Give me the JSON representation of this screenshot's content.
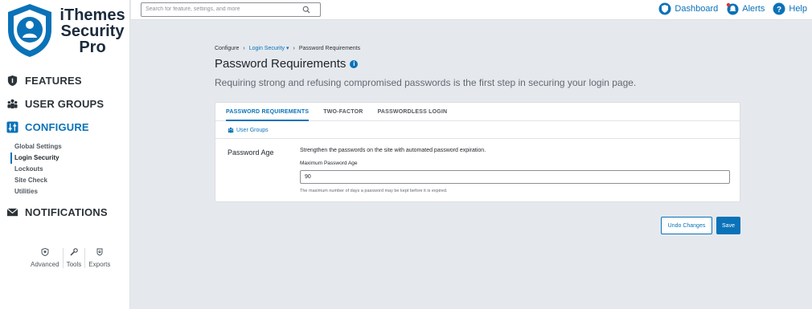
{
  "brand": {
    "line1": "iThemes",
    "line2": "Security",
    "line3": "Pro",
    "accent": "#0a72b8",
    "logo_icon": "shield-user-icon"
  },
  "sidebar": {
    "sections": [
      {
        "label": "FEATURES",
        "icon": "shield-icon"
      },
      {
        "label": "USER GROUPS",
        "icon": "users-icon"
      },
      {
        "label": "CONFIGURE",
        "icon": "sliders-icon"
      },
      {
        "label": "NOTIFICATIONS",
        "icon": "envelope-icon"
      }
    ],
    "configure_items": [
      {
        "label": "Global Settings"
      },
      {
        "label": "Login Security",
        "current": true
      },
      {
        "label": "Lockouts"
      },
      {
        "label": "Site Check"
      },
      {
        "label": "Utilities"
      }
    ],
    "tools": [
      {
        "label": "Advanced",
        "icon": "shield-small-icon"
      },
      {
        "label": "Tools",
        "icon": "wrench-icon"
      },
      {
        "label": "Exports",
        "icon": "export-icon"
      }
    ]
  },
  "topbar": {
    "search_placeholder": "Search for feature, settings, and more",
    "links": [
      {
        "label": "Dashboard",
        "icon": "shield-icon"
      },
      {
        "label": "Alerts",
        "icon": "bell-icon"
      },
      {
        "label": "Help",
        "icon": "question-icon"
      }
    ]
  },
  "breadcrumb": {
    "root": "Configure",
    "middle": "Login Security",
    "current": "Password Requirements"
  },
  "page": {
    "title": "Password Requirements",
    "description": "Requiring strong and refusing compromised passwords is the first step in securing your login page."
  },
  "tabs": [
    {
      "label": "PASSWORD REQUIREMENTS",
      "active": true
    },
    {
      "label": "TWO-FACTOR"
    },
    {
      "label": "PASSWORDLESS LOGIN"
    }
  ],
  "subbar": {
    "user_groups_label": "User Groups"
  },
  "setting": {
    "label": "Password Age",
    "description": "Strengthen the passwords on the site with automated password expiration.",
    "input_label": "Maximum Password Age",
    "input_value": "90",
    "hint": "The maximum number of days a password may be kept before it is expired."
  },
  "actions": {
    "undo_label": "Undo Changes",
    "save_label": "Save"
  }
}
